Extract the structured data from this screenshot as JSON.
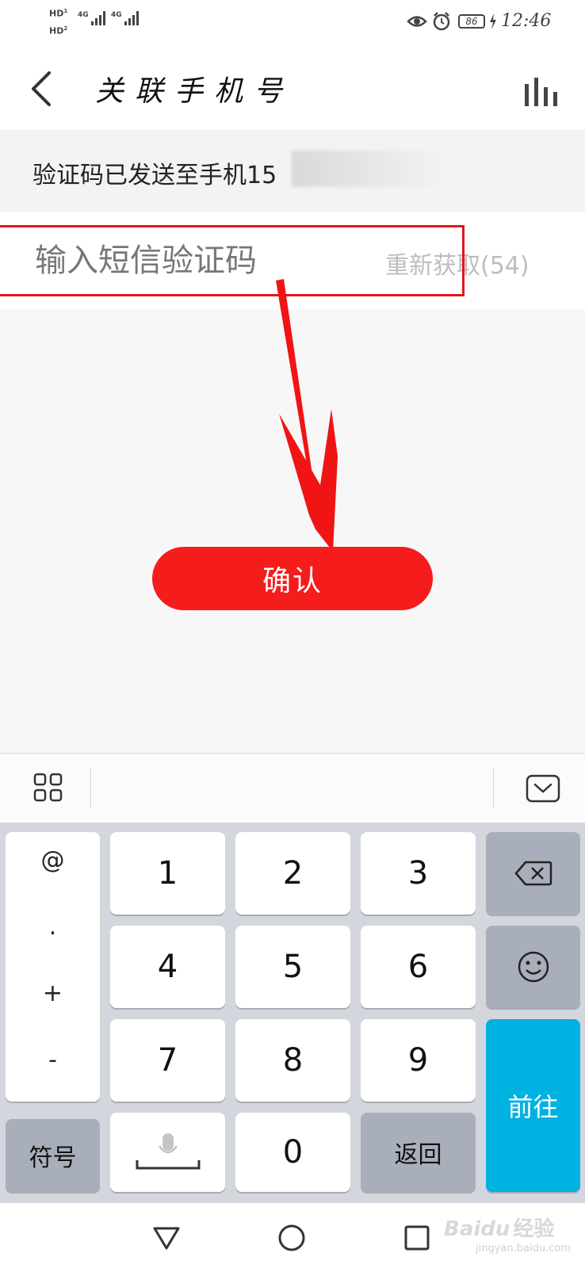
{
  "status_bar": {
    "hd1": "HD",
    "hd1_sub": "1",
    "hd2": "HD",
    "hd2_sub": "2",
    "net1": "4G",
    "net2": "4G",
    "battery": "86",
    "time": "12:46",
    "icons": [
      "eye-icon",
      "alarm-icon",
      "battery-icon",
      "charging-icon"
    ]
  },
  "header": {
    "title": "关联手机号",
    "back_icon": "chevron-left-icon",
    "right_icon": "bars-icon"
  },
  "info": {
    "text": "验证码已发送至手机15"
  },
  "input": {
    "placeholder": "输入短信验证码",
    "value": "",
    "resend": "重新获取(54)"
  },
  "confirm_label": "确认",
  "keyboard": {
    "symbols": [
      "@",
      ".",
      "+",
      "-"
    ],
    "digits": [
      "1",
      "2",
      "3",
      "4",
      "5",
      "6",
      "7",
      "8",
      "9",
      "0"
    ],
    "symbol_key": "符号",
    "return_key": "返回",
    "go_key": "前往",
    "toolbar_icons": [
      "grid-icon",
      "keyboard-collapse-icon"
    ]
  },
  "watermark": {
    "brand": "Bai",
    "brand2": "du",
    "suffix": "经验",
    "url": "jingyan.baidu.com"
  },
  "colors": {
    "accent_red": "#f51c1c",
    "go_blue": "#00b2e1",
    "annotation_red": "#e8131c"
  }
}
